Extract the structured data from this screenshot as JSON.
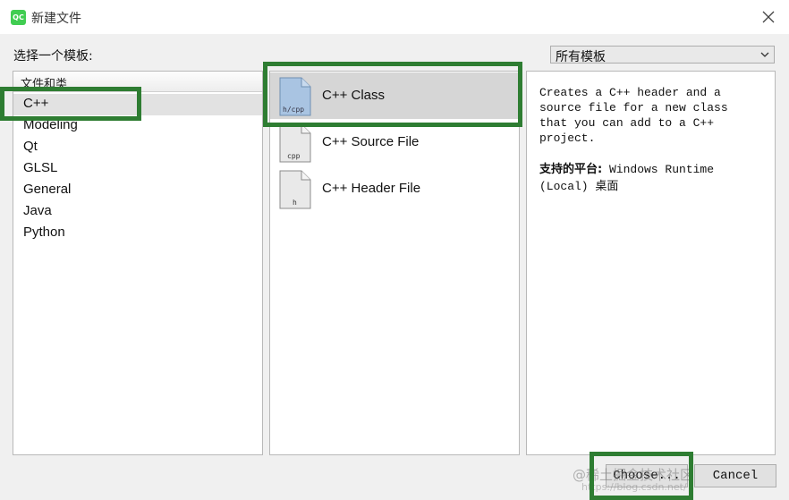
{
  "window": {
    "title": "新建文件",
    "icon_text": "QC"
  },
  "choose_template_label": "选择一个模板:",
  "filter": {
    "selected": "所有模板"
  },
  "categories": {
    "header": "文件和类",
    "items": [
      {
        "label": "C++",
        "selected": true
      },
      {
        "label": "Modeling"
      },
      {
        "label": "Qt"
      },
      {
        "label": "GLSL"
      },
      {
        "label": "General"
      },
      {
        "label": "Java"
      },
      {
        "label": "Python"
      }
    ]
  },
  "templates": [
    {
      "label": "C++ Class",
      "icon": "h/cpp",
      "selected": true
    },
    {
      "label": "C++ Source File",
      "icon": "cpp"
    },
    {
      "label": "C++ Header File",
      "icon": "h"
    }
  ],
  "description": {
    "text": "Creates a C++ header and a\nsource file for a new class\nthat you can add to a C++\nproject.",
    "platforms_label": "支持的平台:",
    "platforms_value": " Windows Runtime (Local) 桌面"
  },
  "buttons": {
    "choose": "Choose...",
    "cancel": "Cancel"
  },
  "watermark": {
    "main": "@稀土掘金技术社区",
    "sub": "https://blog.csdn.net/"
  },
  "colors": {
    "highlight": "#2e7d32",
    "selection": "#d6d6d6",
    "icon_fill_selected": "#a9c4e2"
  }
}
